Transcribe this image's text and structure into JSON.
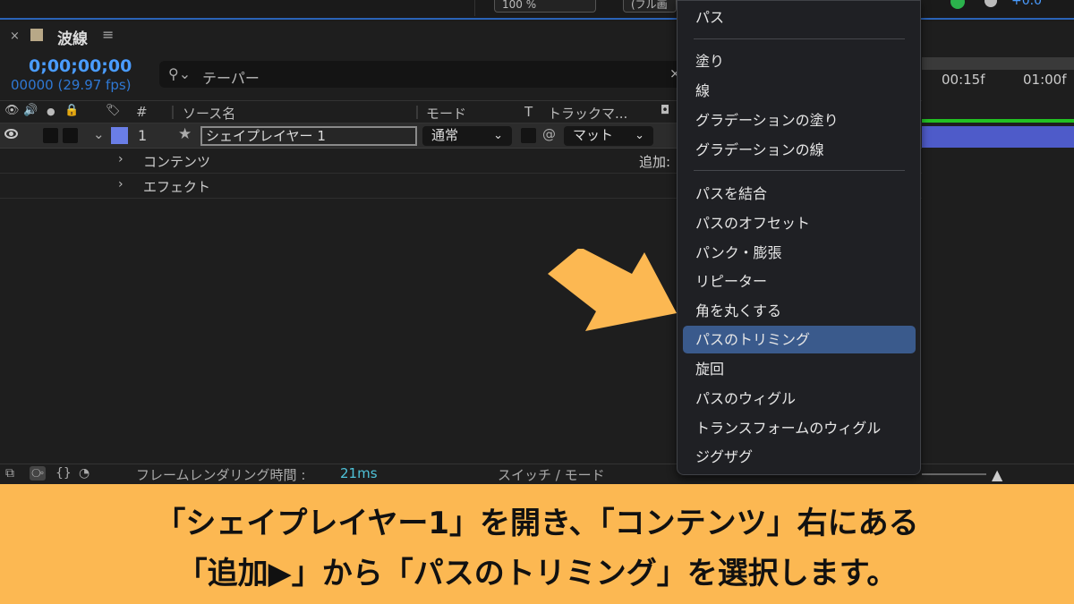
{
  "top": {
    "zoom_value": "100 %",
    "resolution_value": "(フル画",
    "offset_value": "+0.0"
  },
  "panel": {
    "close_glyph": "×",
    "title": "波線",
    "menu_glyph": "≡",
    "timecode": "0;00;00;00",
    "frames": "00000 (29.97 fps)",
    "search": {
      "value": "テーパー",
      "clear": "×"
    },
    "columns": {
      "number": "#",
      "source_name": "ソース名",
      "mode": "モード",
      "t": "T",
      "track_matte": "トラックマ..."
    }
  },
  "layer": {
    "number": "1",
    "name": "シェイプレイヤー 1",
    "mode": "通常",
    "matte": "マット",
    "color": "#6a7ee6"
  },
  "sub_rows": [
    {
      "label": "コンテンツ"
    },
    {
      "label": "エフェクト"
    }
  ],
  "add_label": "追加:",
  "timeline": {
    "tick_1": "00:15f",
    "tick_2": "01:00f"
  },
  "footer": {
    "render_label": "フレームレンダリング時間 :",
    "render_value": "21ms",
    "switch_mode": "スイッチ / モード"
  },
  "menu": {
    "items": [
      "パス",
      "塗り",
      "線",
      "グラデーションの塗り",
      "グラデーションの線",
      "パスを結合",
      "パスのオフセット",
      "パンク・膨張",
      "リピーター",
      "角を丸くする",
      "パスのトリミング",
      "旋回",
      "パスのウィグル",
      "トランスフォームのウィグル",
      "ジグザグ"
    ],
    "selected": "パスのトリミング"
  },
  "caption": {
    "line1": "「シェイプレイヤー1」を開き、「コンテンツ」右にある",
    "line2": "「追加▶」から「パスのトリミング」を選択します。"
  },
  "colors": {
    "accent": "#4a9cff",
    "banner": "#fcb852",
    "highlight": "#3a5a8c",
    "arrow": "#fcb852"
  }
}
